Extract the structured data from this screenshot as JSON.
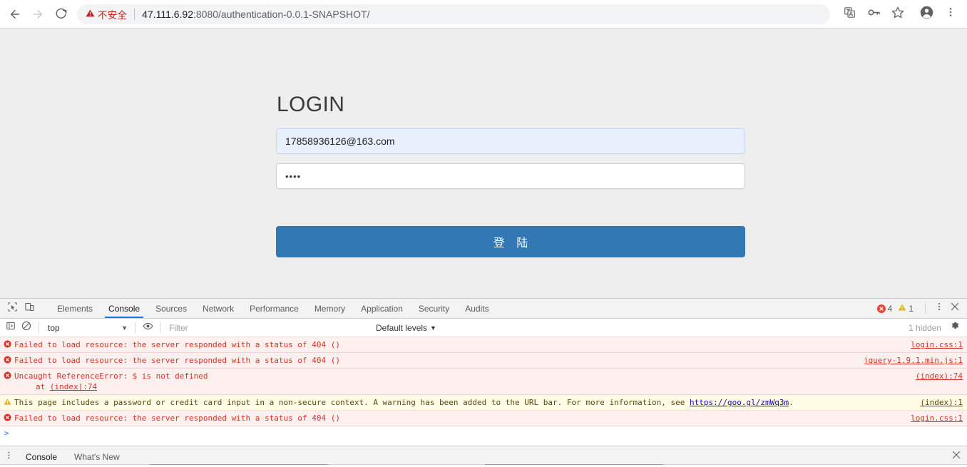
{
  "browser": {
    "back_label": "Back",
    "forward_label": "Forward",
    "reload_label": "Reload",
    "security_label": "不安全",
    "url_host": "47.111.6.92",
    "url_rest": ":8080/authentication-0.0.1-SNAPSHOT/",
    "icons": {
      "back": "back-arrow-icon",
      "forward": "forward-arrow-icon",
      "reload": "reload-icon",
      "warning": "warning-triangle-icon",
      "translate": "translate-icon",
      "password": "key-icon",
      "bookmark": "star-icon",
      "profile": "profile-avatar-icon",
      "menu": "three-dot-menu-icon"
    }
  },
  "login": {
    "title": "LOGIN",
    "email_value": "17858936126@163.com",
    "email_placeholder": "",
    "password_value": "••••",
    "password_placeholder": "",
    "submit_label": "登 陆",
    "button_color": "#3278b4",
    "autofill_color": "#e8f0fe"
  },
  "devtools": {
    "tool_icons": {
      "inspect": "inspect-element-icon",
      "device": "device-toolbar-icon"
    },
    "tabs": [
      {
        "label": "Elements",
        "active": false
      },
      {
        "label": "Console",
        "active": true
      },
      {
        "label": "Sources",
        "active": false
      },
      {
        "label": "Network",
        "active": false
      },
      {
        "label": "Performance",
        "active": false
      },
      {
        "label": "Memory",
        "active": false
      },
      {
        "label": "Application",
        "active": false
      },
      {
        "label": "Security",
        "active": false
      },
      {
        "label": "Audits",
        "active": false
      }
    ],
    "status": {
      "error_count": "4",
      "warning_count": "1",
      "error_color": "#ef4136",
      "warning_color": "#e8b321"
    },
    "more_label": "Customize and control DevTools",
    "close_label": "Close DevTools",
    "filterbar": {
      "sidebar_toggle": "console-sidebar-icon",
      "clear_label": "clear-console-icon",
      "context": "top",
      "eye_icon": "live-expression-eye-icon",
      "filter_placeholder": "Filter",
      "filter_value": "",
      "levels": "Default levels",
      "hidden_count": "1 hidden",
      "settings_icon": "gear-icon"
    },
    "messages": [
      {
        "level": "error",
        "text": "Failed to load resource: the server responded with a status of 404 ()",
        "source": "login.css:1",
        "stack": "",
        "link": ""
      },
      {
        "level": "error",
        "text": "Failed to load resource: the server responded with a status of 404 ()",
        "source": "jquery-1.9.1.min.js:1",
        "stack": "",
        "link": ""
      },
      {
        "level": "error",
        "text": "Uncaught ReferenceError: $ is not defined",
        "source": "(index):74",
        "stack_prefix": "    at ",
        "stack_link": "(index):74",
        "link": ""
      },
      {
        "level": "warning",
        "text_before": "This page includes a password or credit card input in a non-secure context. A warning has been added to the URL bar. For more information, see ",
        "link": "https://goo.gl/zmWq3m",
        "text_after": ".",
        "source": "(index):1"
      },
      {
        "level": "error",
        "text": "Failed to load resource: the server responded with a status of 404 ()",
        "source": "login.css:1",
        "stack": "",
        "link": ""
      }
    ],
    "prompt_caret": ">",
    "drawer": {
      "menu_icon": "drawer-menu-icon",
      "tabs": [
        {
          "label": "Console",
          "active": true
        },
        {
          "label": "What's New",
          "active": false
        }
      ],
      "close_icon": "close-icon"
    }
  }
}
